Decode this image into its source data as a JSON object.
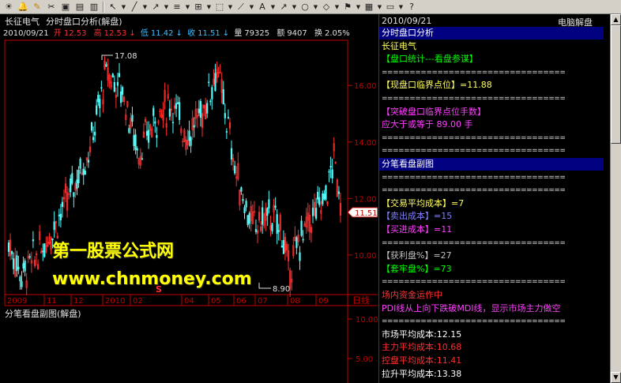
{
  "toolbar": {
    "icons": [
      "sun-icon",
      "bell-icon",
      "pencil-icon",
      "scissors-icon",
      "box-icon",
      "chart-icon",
      "chart2-icon",
      "cursor-icon",
      "line-icon",
      "ray-icon",
      "parallel-icon",
      "grid-icon",
      "select-icon",
      "channel-icon",
      "text-icon",
      "arrow-icon",
      "circle-icon",
      "shape-icon",
      "flag-icon",
      "palette-icon",
      "save-icon",
      "help-icon"
    ],
    "text_glyph": "A"
  },
  "header": {
    "stock_name": "长征电气",
    "window_name": "分时盘口分析(解盘)"
  },
  "quote": {
    "date": "2010/09/21",
    "open_label": "开",
    "open": "12.53",
    "high_label": "高",
    "high": "12.53",
    "low_label": "低",
    "low": "11.42",
    "close_label": "收",
    "close": "11.51",
    "vol_label": "量",
    "vol": "79325",
    "amt_label": "额",
    "amt": "9407",
    "turn_label": "换",
    "turn": "2.05%"
  },
  "chart_data": {
    "type": "candlestick",
    "price_axis": {
      "ticks": [
        "16.00",
        "14.00",
        "12.00",
        "10.00"
      ],
      "ylim": [
        8.6,
        17.6
      ]
    },
    "current_price": "11.51",
    "annotations": {
      "max": "17.08",
      "min": "8.90"
    },
    "x_ticks": [
      "2009",
      "11",
      "12",
      "2010",
      "02",
      "04",
      "05",
      "06",
      "07",
      "08",
      "09"
    ],
    "period_label": "日线",
    "marker": "S",
    "subchart": {
      "title": "分笔看盘副图(解盘)",
      "ticks": [
        "10.00",
        "5.00"
      ]
    }
  },
  "watermark": {
    "line1": "第一股票公式网",
    "line2": "www.chnmoney.com"
  },
  "sidebar": {
    "date": "2010/09/21",
    "right_title": "电脑解盘",
    "rows": [
      {
        "text": "分时盘口分析",
        "color": "#ffffff",
        "hl": true
      },
      {
        "text": "长征电气",
        "color": "#ffff60"
      },
      {
        "text": "  【盘口统计---看盘参谋】",
        "color": "#00ff00"
      },
      {
        "text": "=================================",
        "color": "#e0e0e0"
      },
      {
        "text": "【现盘口临界点位】=11.88",
        "color": "#ffff60"
      },
      {
        "text": "=================================",
        "color": "#e0e0e0"
      },
      {
        "text": "【突破盘口临界点位手数】",
        "color": "#ff40ff"
      },
      {
        "text": " 应大于或等于  89.00  手",
        "color": "#ff40ff"
      },
      {
        "text": "=================================",
        "color": "#e0e0e0"
      },
      {
        "text": "=================================",
        "color": "#e0e0e0"
      },
      {
        "text": "分笔看盘副图",
        "color": "#ffffff",
        "hl": true
      },
      {
        "text": "=================================",
        "color": "#e0e0e0"
      },
      {
        "text": "=================================",
        "color": "#e0e0e0"
      },
      {
        "text": "【交易平均成本】=7",
        "color": "#ffff60"
      },
      {
        "text": "【卖出成本】=15",
        "color": "#8080ff"
      },
      {
        "text": "【买进成本】=11",
        "color": "#ff40ff"
      },
      {
        "text": "=================================",
        "color": "#e0e0e0"
      },
      {
        "text": "【获利盘%】=27",
        "color": "#c0c0c0"
      },
      {
        "text": "【套牢盘%】=73",
        "color": "#00ff00"
      },
      {
        "text": "=================================",
        "color": "#e0e0e0"
      },
      {
        "text": "场内资金运作中",
        "color": "#ff3030"
      },
      {
        "text": "PDI线从上向下跌破MDI线，显示市场主力做空",
        "color": "#ff40ff"
      },
      {
        "text": "=================================",
        "color": "#e0e0e0"
      },
      {
        "text": "市场平均成本:12.15",
        "color": "#ffffff"
      },
      {
        "text": "主力平均成本:10.68",
        "color": "#ff3030"
      },
      {
        "text": "控盘平均成本:11.41",
        "color": "#ff3030"
      },
      {
        "text": "拉升平均成本:13.38",
        "color": "#ffffff"
      }
    ]
  }
}
